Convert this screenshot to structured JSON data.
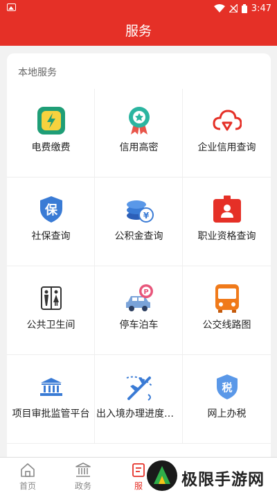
{
  "status_bar": {
    "time": "3:47"
  },
  "app_bar": {
    "title": "服务"
  },
  "section": {
    "title": "本地服务",
    "items": [
      {
        "label": "电费缴费",
        "icon": "electricity-bill-icon"
      },
      {
        "label": "信用高密",
        "icon": "credit-badge-icon"
      },
      {
        "label": "企业信用查询",
        "icon": "cloud-check-icon"
      },
      {
        "label": "社保查询",
        "icon": "shield-bao-icon"
      },
      {
        "label": "公积金查询",
        "icon": "coins-yen-icon"
      },
      {
        "label": "职业资格查询",
        "icon": "id-badge-icon"
      },
      {
        "label": "公共卫生间",
        "icon": "restroom-icon"
      },
      {
        "label": "停车泊车",
        "icon": "parking-car-icon"
      },
      {
        "label": "公交线路图",
        "icon": "bus-icon"
      },
      {
        "label": "项目审批监管平台",
        "icon": "government-building-icon"
      },
      {
        "label": "出入境办理进度查...",
        "icon": "airplane-icon"
      },
      {
        "label": "网上办税",
        "icon": "tax-shield-icon"
      }
    ]
  },
  "tab_bar": {
    "tabs": [
      {
        "label": "首页",
        "icon": "home-icon"
      },
      {
        "label": "政务",
        "icon": "government-icon"
      },
      {
        "label": "服",
        "icon": "service-icon"
      }
    ]
  },
  "watermark": {
    "text": "极限手游网"
  },
  "colors": {
    "brand_red": "#e53027",
    "blue": "#3a7bd5",
    "teal": "#2bb5a0",
    "orange": "#f07a1a"
  }
}
